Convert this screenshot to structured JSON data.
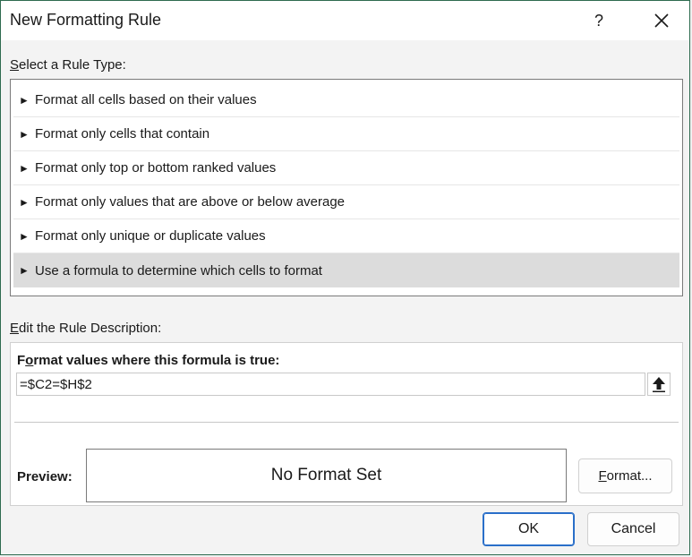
{
  "window": {
    "title": "New Formatting Rule",
    "help_label": "?"
  },
  "rule_type": {
    "label_accel": "S",
    "label_rest": "elect a Rule Type:",
    "items": [
      {
        "label": "Format all cells based on their values",
        "selected": false
      },
      {
        "label": "Format only cells that contain",
        "selected": false
      },
      {
        "label": "Format only top or bottom ranked values",
        "selected": false
      },
      {
        "label": "Format only values that are above or below average",
        "selected": false
      },
      {
        "label": "Format only unique or duplicate values",
        "selected": false
      },
      {
        "label": "Use a formula to determine which cells to format",
        "selected": true
      }
    ],
    "arrow_glyph": "►"
  },
  "description": {
    "label_accel": "E",
    "label_rest": "dit the Rule Description:",
    "formula_label_a": "F",
    "formula_label_accel": "o",
    "formula_label_b": "rmat values where this formula is true:",
    "formula_value": "=$C2=$H$2",
    "preview_label": "Preview:",
    "preview_text": "No Format Set",
    "format_button_accel": "F",
    "format_button_rest": "ormat..."
  },
  "footer": {
    "ok_label": "OK",
    "cancel_label": "Cancel"
  },
  "colors": {
    "accent": "#2a6fc9",
    "selected_row": "#dcdcdc"
  }
}
